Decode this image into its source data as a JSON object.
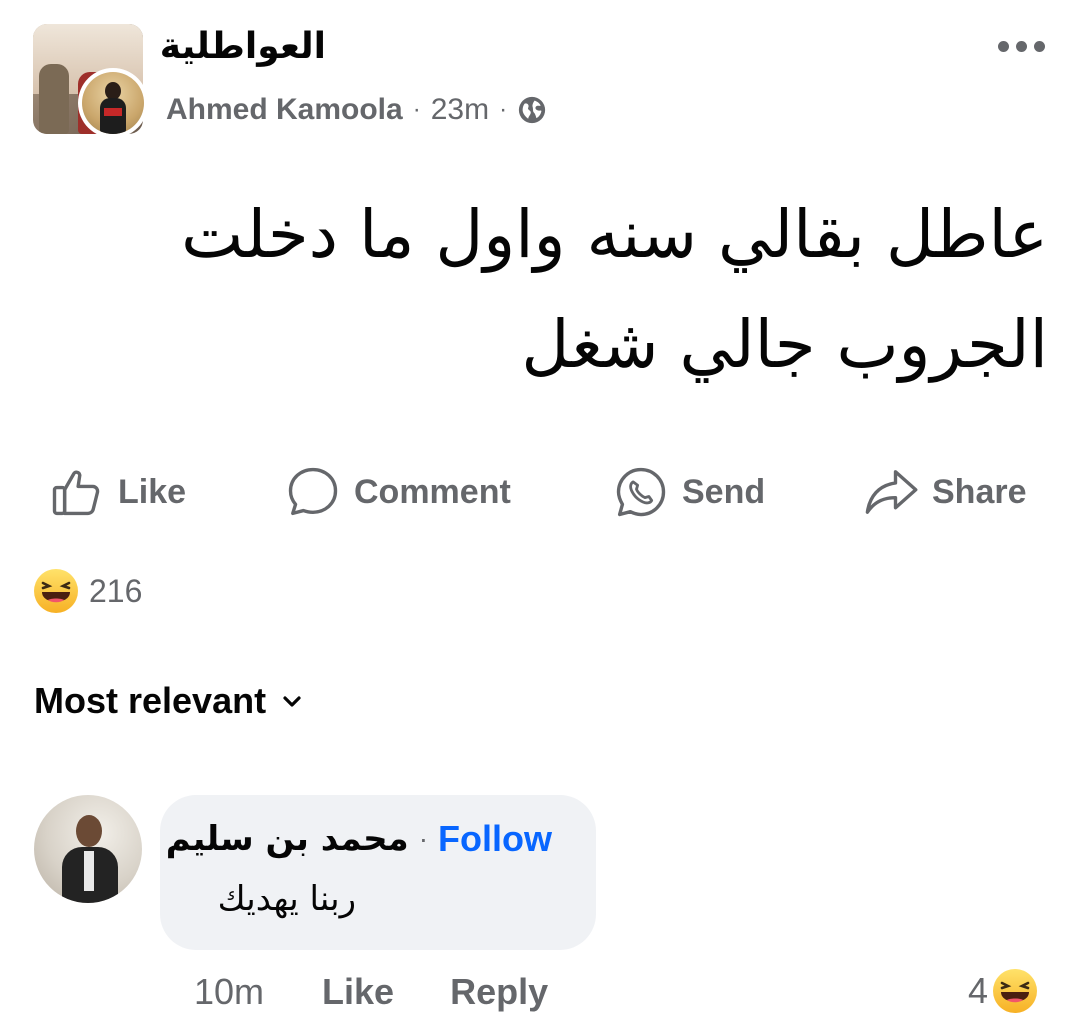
{
  "header": {
    "group_name": "العواطلية",
    "author_name": "Ahmed Kamoola",
    "time": "23m",
    "separator": "·",
    "privacy_icon": "globe-icon",
    "more_icon": "more-options-icon"
  },
  "post": {
    "text": "عاطل بقالي سنه واول ما دخلت الجروب جالي شغل"
  },
  "actions": {
    "like": "Like",
    "comment": "Comment",
    "send": "Send",
    "share": "Share"
  },
  "reactions": {
    "icon": "haha-emoji",
    "count": "216"
  },
  "sort": {
    "label": "Most relevant",
    "icon": "chevron-down-icon"
  },
  "comment": {
    "author": "محمد بن سليم",
    "follow": "Follow",
    "separator": "·",
    "text": "ربنا يهديك",
    "time": "10m",
    "like": "Like",
    "reply": "Reply",
    "reaction_count": "4",
    "reaction_icon": "haha-emoji"
  },
  "colors": {
    "secondary_text": "#65676b",
    "link_blue": "#0866ff",
    "bubble_bg": "#f0f2f5"
  }
}
